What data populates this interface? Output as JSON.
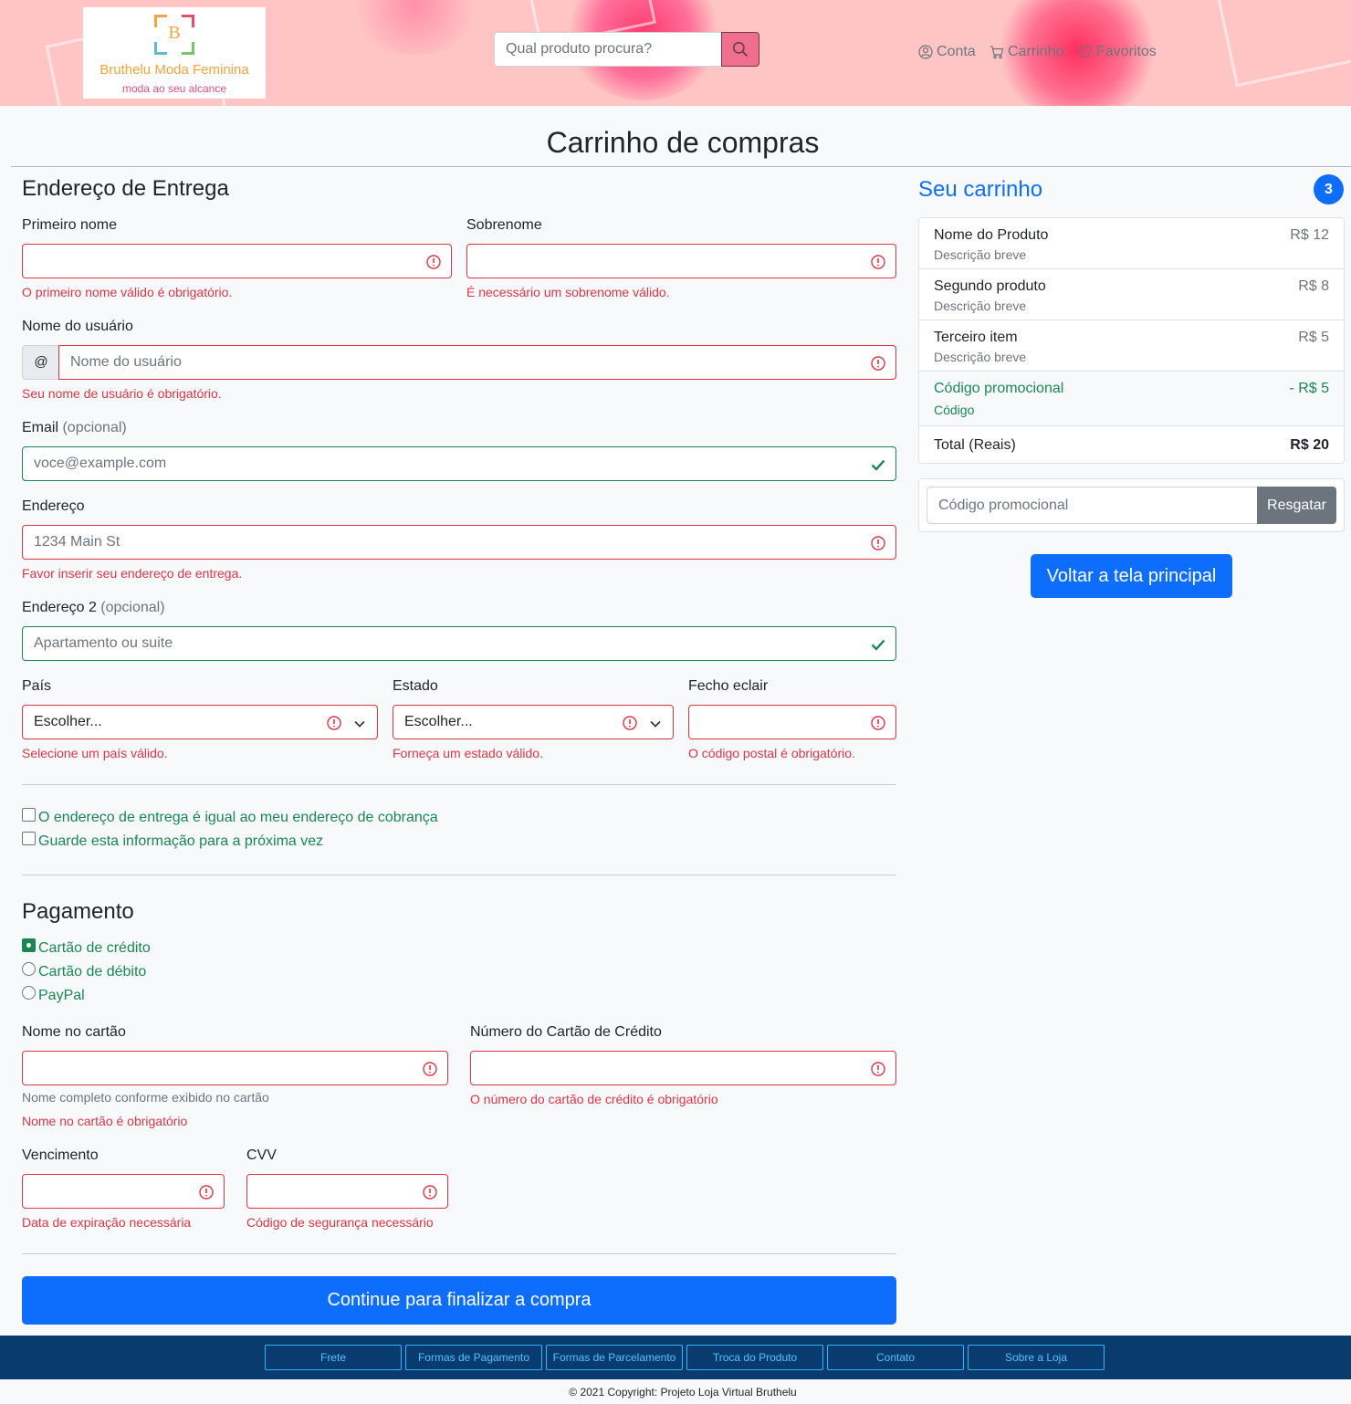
{
  "header": {
    "logo": {
      "letter": "B",
      "title": "Bruthelu Moda Feminina",
      "subtitle": "moda ao seu alcance"
    },
    "search_placeholder": "Qual produto procura?",
    "nav": {
      "account": "Conta",
      "cart": "Carrinho",
      "favorites": "Favoritos"
    }
  },
  "page_title": "Carrinho de compras",
  "shipping": {
    "heading": "Endereço de Entrega",
    "first_name": {
      "label": "Primeiro nome",
      "error": "O primeiro nome válido é obrigatório."
    },
    "last_name": {
      "label": "Sobrenome",
      "error": "É necessário um sobrenome válido."
    },
    "username": {
      "label": "Nome do usuário",
      "prefix": "@",
      "placeholder": "Nome do usuário",
      "error": "Seu nome de usuário é obrigatório."
    },
    "email": {
      "label": "Email",
      "optional": "(opcional)",
      "placeholder": "voce@example.com"
    },
    "address": {
      "label": "Endereço",
      "placeholder": "1234 Main St",
      "error": "Favor inserir seu endereço de entrega."
    },
    "address2": {
      "label": "Endereço 2",
      "optional": "(opcional)",
      "placeholder": "Apartamento ou suite"
    },
    "country": {
      "label": "País",
      "value": "Escolher...",
      "error": "Selecione um país válido."
    },
    "state": {
      "label": "Estado",
      "value": "Escolher...",
      "error": "Forneça um estado válido."
    },
    "zip": {
      "label": "Fecho eclair",
      "error": "O código postal é obrigatório."
    },
    "same_address": "O endereço de entrega é igual ao meu endereço de cobrança",
    "save_info": "Guarde esta informação para a próxima vez"
  },
  "payment": {
    "heading": "Pagamento",
    "methods": [
      {
        "label": "Cartão de crédito",
        "checked": true
      },
      {
        "label": "Cartão de débito",
        "checked": false
      },
      {
        "label": "PayPal",
        "checked": false
      }
    ],
    "card_name": {
      "label": "Nome no cartão",
      "hint": "Nome completo conforme exibido no cartão",
      "error": "Nome no cartão é obrigatório"
    },
    "card_number": {
      "label": "Número do Cartão de Crédito",
      "error": "O número do cartão de crédito é obrigatório"
    },
    "expiry": {
      "label": "Vencimento",
      "error": "Data de expiração necessária"
    },
    "cvv": {
      "label": "CVV",
      "error": "Código de segurança necessário"
    },
    "submit": "Continue para finalizar a compra"
  },
  "cart": {
    "title": "Seu carrinho",
    "count": "3",
    "items": [
      {
        "name": "Nome do Produto",
        "desc": "Descrição breve",
        "price": "R$ 12"
      },
      {
        "name": "Segundo produto",
        "desc": "Descrição breve",
        "price": "R$ 8"
      },
      {
        "name": "Terceiro item",
        "desc": "Descrição breve",
        "price": "R$ 5"
      }
    ],
    "promo": {
      "name": "Código promocional",
      "desc": "Código",
      "price": "- R$ 5"
    },
    "total": {
      "label": "Total (Reais)",
      "value": "R$ 20"
    },
    "promo_input_placeholder": "Código promocional",
    "redeem": "Resgatar",
    "back": "Voltar a tela principal"
  },
  "footer": {
    "links": [
      "Frete",
      "Formas de Pagamento",
      "Formas de Parcelamento",
      "Troca do Produto",
      "Contato",
      "Sobre a Loja"
    ],
    "copyright": "© 2021 Copyright: Projeto Loja Virtual Bruthelu"
  },
  "colors": {
    "primary": "#0d6efd",
    "danger": "#dc3545",
    "success": "#198754",
    "footer": "#0a3b6e"
  }
}
